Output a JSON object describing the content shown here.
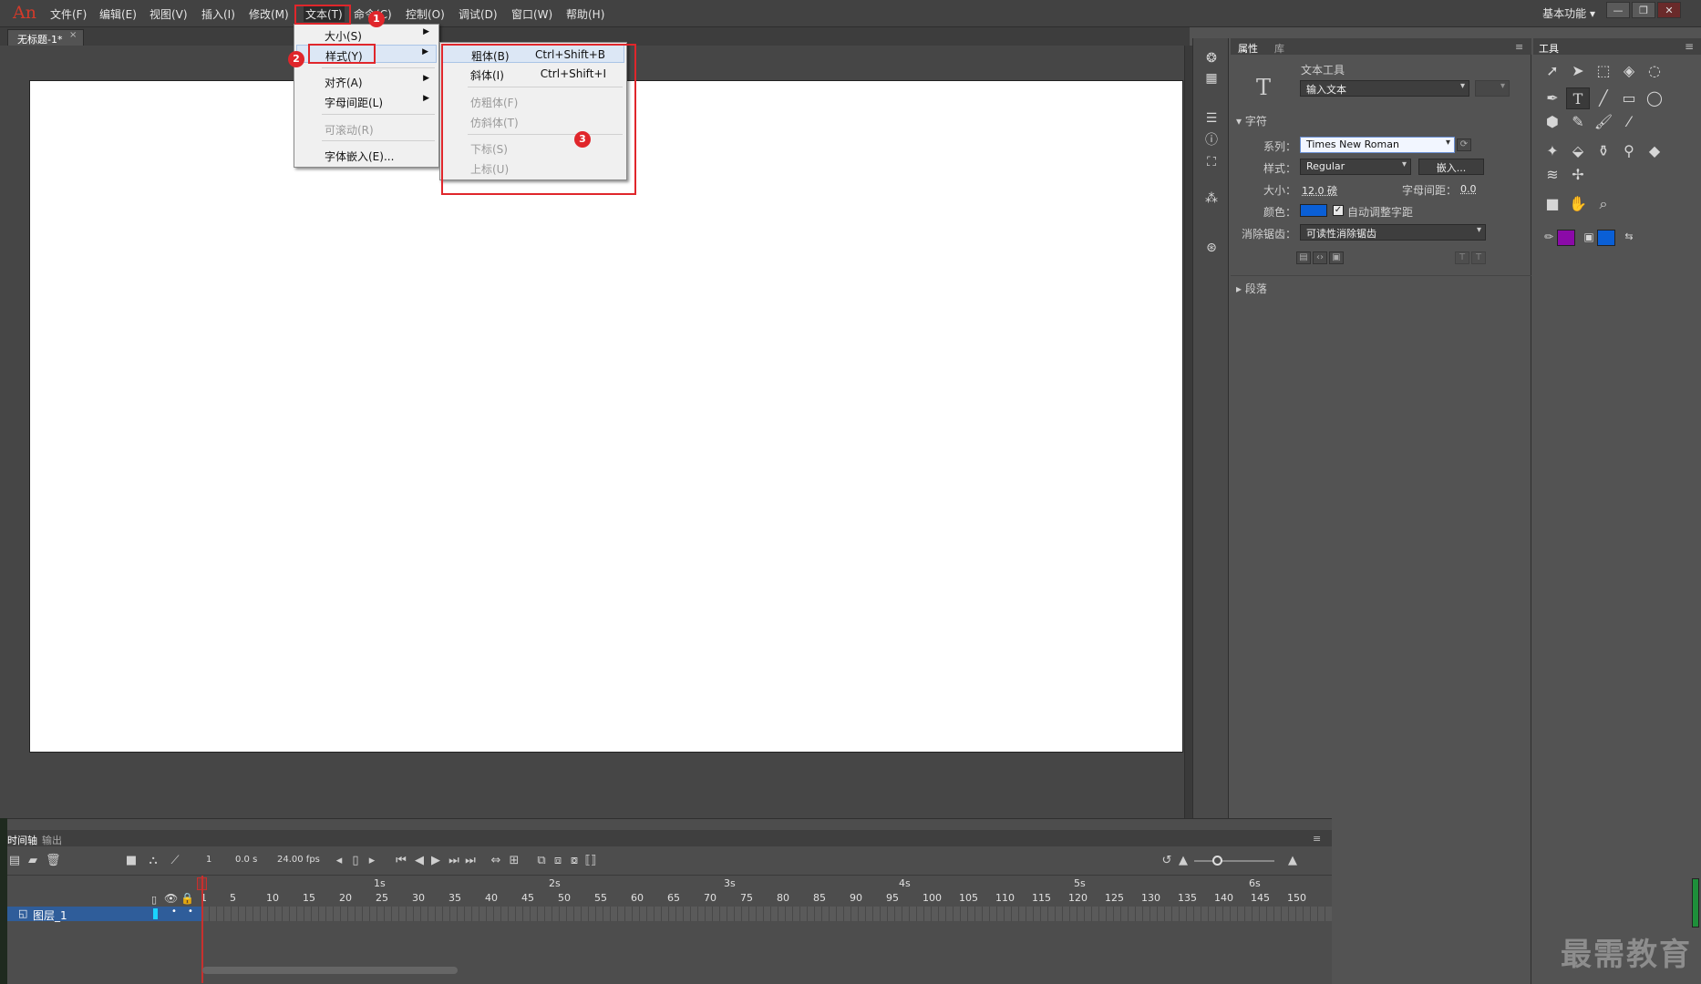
{
  "menubar": {
    "logo": "An",
    "items": [
      "文件(F)",
      "编辑(E)",
      "视图(V)",
      "插入(I)",
      "修改(M)",
      "文本(T)",
      "命令(C)",
      "控制(O)",
      "调试(D)",
      "窗口(W)",
      "帮助(H)"
    ],
    "workspace": "基本功能",
    "window_buttons": [
      "—",
      "❐",
      "✕"
    ]
  },
  "document": {
    "tab_title": "无标题-1*",
    "tab_close": "×"
  },
  "text_menu": {
    "items": [
      {
        "label": "大小(S)",
        "submenu": true
      },
      {
        "label": "样式(Y)",
        "submenu": true
      },
      {
        "label": "对齐(A)",
        "submenu": true
      },
      {
        "label": "字母间距(L)",
        "submenu": true
      },
      {
        "label": "可滚动(R)",
        "disabled": true
      },
      {
        "label": "字体嵌入(E)..."
      }
    ]
  },
  "style_submenu": {
    "items": [
      {
        "label": "粗体(B)",
        "shortcut": "Ctrl+Shift+B"
      },
      {
        "label": "斜体(I)",
        "shortcut": "Ctrl+Shift+I"
      },
      {
        "label": "仿粗体(F)",
        "disabled": true
      },
      {
        "label": "仿斜体(T)",
        "disabled": true
      },
      {
        "label": "下标(S)",
        "disabled": true
      },
      {
        "label": "上标(U)",
        "disabled": true
      }
    ]
  },
  "annotations": {
    "badge1": "1",
    "badge2": "2",
    "badge3": "3"
  },
  "properties": {
    "tabs": [
      "属性",
      "库"
    ],
    "tool_name": "文本工具",
    "text_type": "输入文本",
    "character_section": "字符",
    "family_label": "系列：",
    "family_value": "Times New Roman",
    "style_label": "样式：",
    "style_value": "Regular",
    "embed_button": "嵌入...",
    "size_label": "大小：",
    "size_value": "12.0 磅",
    "letter_spacing_label": "字母间距：",
    "letter_spacing_value": "0.0",
    "color_label": "颜色：",
    "text_color": "#0a5fd6",
    "auto_kern_label": "自动调整字距",
    "antialias_label": "消除锯齿：",
    "antialias_value": "可读性消除锯齿",
    "paragraph_section": "段落"
  },
  "tools": {
    "title": "工具",
    "stroke_color": "#8b0aa8",
    "fill_color": "#0a5fd6"
  },
  "timeline": {
    "tabs": [
      "时间轴",
      "输出"
    ],
    "current_frame": "1",
    "elapsed": "0.0 s",
    "fps": "24.00 fps",
    "seconds": [
      "1s",
      "2s",
      "3s",
      "4s",
      "5s",
      "6s"
    ],
    "frame_numbers": [
      "1",
      "5",
      "10",
      "15",
      "20",
      "25",
      "30",
      "35",
      "40",
      "45",
      "50",
      "55",
      "60",
      "65",
      "70",
      "75",
      "80",
      "85",
      "90",
      "95",
      "100",
      "105",
      "110",
      "115",
      "120",
      "125",
      "130",
      "135",
      "140",
      "145",
      "150"
    ],
    "layer_name": "图层_1"
  },
  "watermark": "最需教育"
}
